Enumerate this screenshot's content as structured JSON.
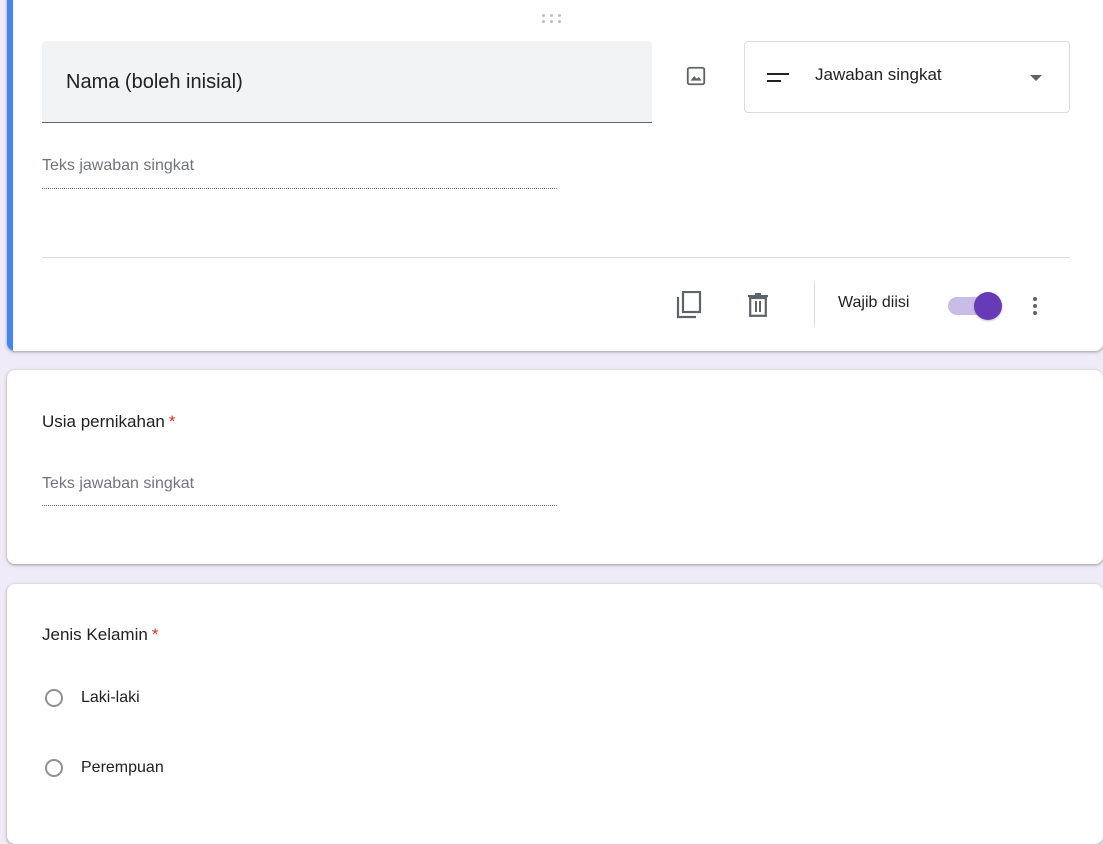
{
  "questions": [
    {
      "title": "Nama (boleh inisial)",
      "type_label": "Jawaban singkat",
      "answer_placeholder": "Teks jawaban singkat",
      "required_label": "Wajib diisi",
      "required_on": true
    },
    {
      "title": "Usia pernikahan",
      "required_marker": "*",
      "answer_placeholder": "Teks jawaban singkat"
    },
    {
      "title": "Jenis Kelamin",
      "required_marker": "*",
      "options": [
        "Laki-laki",
        "Perempuan"
      ]
    }
  ],
  "icons": {
    "drag": "drag-handle-icon",
    "image": "image-icon",
    "short_answer": "short-text-icon",
    "dropdown": "arrow-drop-down-icon",
    "duplicate": "copy-icon",
    "delete": "trash-icon",
    "more": "more-vert-icon"
  },
  "colors": {
    "accent_bar": "#4285f4",
    "toggle_thumb": "#673ab7",
    "toggle_track": "#c9bde8",
    "required_star": "#d93025",
    "background": "#f0ebf8"
  }
}
